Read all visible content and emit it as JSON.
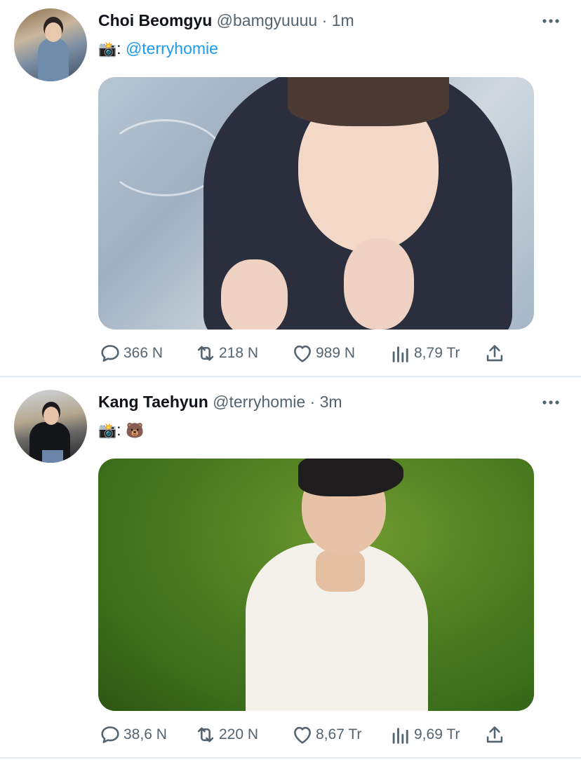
{
  "colors": {
    "accent": "#1d9bf0",
    "text": "#0f1419",
    "muted": "#536471",
    "divider": "#e6ecf0"
  },
  "tweets": [
    {
      "name": "Choi Beomgyu",
      "handle": "@bamgyuuuu",
      "dot": "·",
      "time": "1m",
      "more_icon": "more-horizontal-icon",
      "text_emoji": "📸",
      "text_colon": ":",
      "mention": "@terryhomie",
      "stats": {
        "replies": "366 N",
        "retweets": "218 N",
        "likes": "989 N",
        "views": "8,79 Tr"
      }
    },
    {
      "name": "Kang Taehyun",
      "handle": "@terryhomie",
      "dot": "·",
      "time": "3m",
      "more_icon": "more-horizontal-icon",
      "text_emoji": "📸",
      "text_colon": ":",
      "text_bear": "🐻",
      "stats": {
        "replies": "38,6 N",
        "retweets": "220 N",
        "likes": "8,67 Tr",
        "views": "9,69 Tr"
      }
    }
  ],
  "icons": [
    "reply-icon",
    "retweet-icon",
    "like-icon",
    "views-icon",
    "share-icon"
  ]
}
